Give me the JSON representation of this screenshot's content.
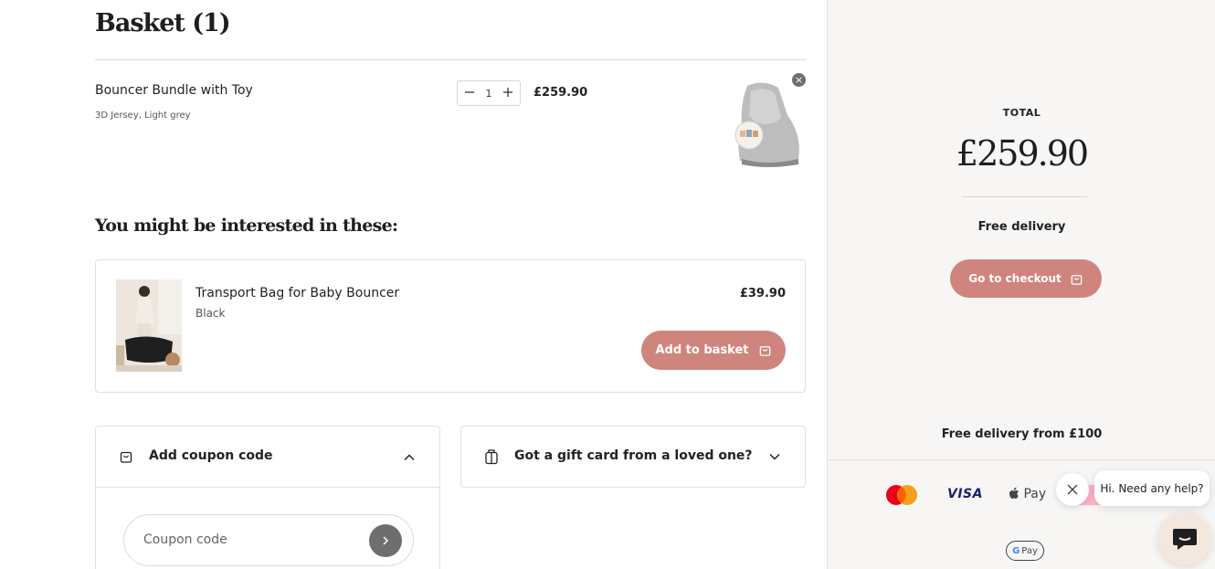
{
  "basket": {
    "title": "Basket (1)",
    "item": {
      "name": "Bouncer Bundle with Toy",
      "variant": "3D Jersey, Light grey",
      "quantity": "1",
      "price": "£259.90",
      "remove_glyph": "×"
    }
  },
  "recommendations": {
    "title": "You might be interested in these:",
    "items": [
      {
        "name": "Transport Bag for Baby Bouncer",
        "variant": "Black",
        "price": "£39.90",
        "button_label": "Add to basket"
      }
    ]
  },
  "coupon": {
    "label": "Add coupon code",
    "placeholder": "Coupon code"
  },
  "gift_card": {
    "label": "Got a gift card from a loved one?"
  },
  "summary": {
    "total_label": "TOTAL",
    "total_amount": "£259.90",
    "delivery": "Free delivery",
    "checkout_label": "Go to checkout",
    "free_delivery_from": "Free delivery from £100"
  },
  "payment_methods": {
    "visa": "VISA",
    "apple_pay": "Pay",
    "google_pay": "Pay"
  },
  "chat": {
    "greeting": "Hi. Need any help?"
  },
  "icons": {
    "basket": "shopping-bag-icon",
    "gift": "gift-card-icon",
    "chevron_up": "chevron-up-icon",
    "chevron_down": "chevron-down-icon",
    "arrow": "arrow-right-icon",
    "chat": "chat-icon",
    "close": "close-icon"
  },
  "colors": {
    "accent": "#cf857d",
    "sidebar_bg": "#f7f6f4",
    "text": "#1e1e1e"
  }
}
